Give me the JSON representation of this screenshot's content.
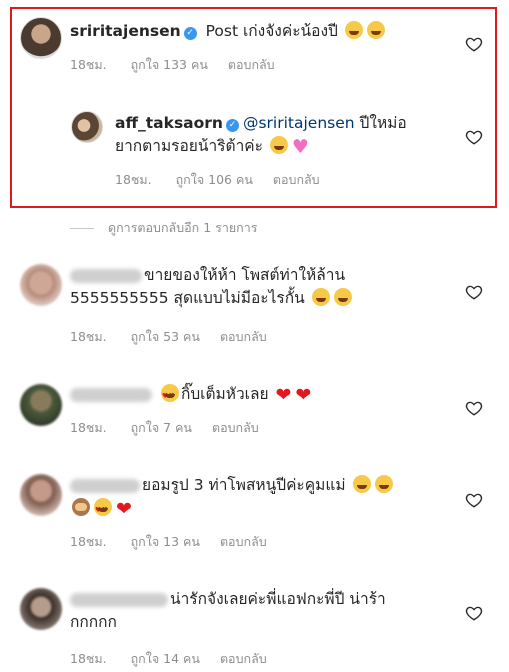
{
  "comments": [
    {
      "username": "sriritajensen",
      "text": "Post เก่งจังค่ะน้องปี",
      "time": "18ชม.",
      "likes": "ถูกใจ 133 คน",
      "reply_label": "ตอบกลับ"
    },
    {
      "username": "aff_taksaorn",
      "mention": "@sriritajensen",
      "text_line1": "ปีใหม่อ",
      "text_line2": "ยากตามรอยน้าริต้าค่ะ",
      "time": "18ชม.",
      "likes": "ถูกใจ 106 คน",
      "reply_label": "ตอบกลับ"
    },
    {
      "text_line1": "ขายของให้ห้า โพสต์ท่าให้ล้าน",
      "text_line2": "5555555555 สุดแบบไม่มีอะไรกั้น",
      "time": "18ชม.",
      "likes": "ถูกใจ 53 คน",
      "reply_label": "ตอบกลับ"
    },
    {
      "text": "กิ๊บเต็มหัวเลย",
      "time": "18ชม.",
      "likes": "ถูกใจ 7 คน",
      "reply_label": "ตอบกลับ"
    },
    {
      "text_line1": "ยอมรูป 3 ท่าโพสหนูปีค่ะคูมแม่",
      "time": "18ชม.",
      "likes": "ถูกใจ 13 คน",
      "reply_label": "ตอบกลับ"
    },
    {
      "text_line1": "น่ารักจังเลยค่ะพี่แอฟกะพี่ปี น่าร้า",
      "text_line2": "กกกกก",
      "time": "18ชม.",
      "likes": "ถูกใจ 14 คน",
      "reply_label": "ตอบกลับ"
    }
  ],
  "view_replies": "ดูการตอบกลับอีก 1 รายการ",
  "icons": {
    "verified": "verified-badge-icon",
    "like": "heart-outline-icon"
  },
  "colors": {
    "highlight_border": "#e0191f",
    "verified_blue": "#3897f0",
    "mention": "#00376b",
    "meta_gray": "#8e8e8e"
  }
}
